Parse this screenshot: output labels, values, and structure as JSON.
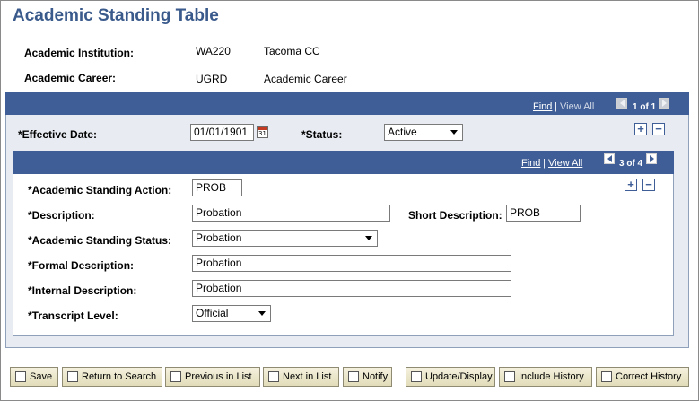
{
  "page": {
    "title": "Academic Standing Table"
  },
  "header": {
    "institution_label": "Academic Institution:",
    "institution_code": "WA220",
    "institution_name": "Tacoma CC",
    "career_label": "Academic Career:",
    "career_code": "UGRD",
    "career_name": "Academic Career"
  },
  "outer_nav": {
    "find": "Find",
    "sep": "|",
    "view_all": "View All",
    "count": "1 of 1"
  },
  "effective": {
    "date_label": "*Effective Date:",
    "date_value": "01/01/1901",
    "status_label": "*Status:",
    "status_value": "Active"
  },
  "inner_nav": {
    "find": "Find",
    "sep": "|",
    "view_all": "View All",
    "count": "3 of 4"
  },
  "form": {
    "action_label": "*Academic Standing Action:",
    "action_value": "PROB",
    "description_label": "*Description:",
    "description_value": "Probation",
    "short_desc_label": "Short Description:",
    "short_desc_value": "PROB",
    "status_label": "*Academic Standing Status:",
    "status_value": "Probation",
    "formal_label": "*Formal Description:",
    "formal_value": "Probation",
    "internal_label": "*Internal Description:",
    "internal_value": "Probation",
    "transcript_label": "*Transcript Level:",
    "transcript_value": "Official"
  },
  "toolbar": {
    "save": "Save",
    "return_to_search": "Return to Search",
    "previous_in_list": "Previous in List",
    "next_in_list": "Next in List",
    "notify": "Notify",
    "update_display": "Update/Display",
    "include_history": "Include History",
    "correct_history": "Correct History"
  },
  "colors": {
    "title": "#3a5a8c",
    "bar": "#3f5e97",
    "panel": "#e8ecf2",
    "button": "#e2dcb9"
  }
}
